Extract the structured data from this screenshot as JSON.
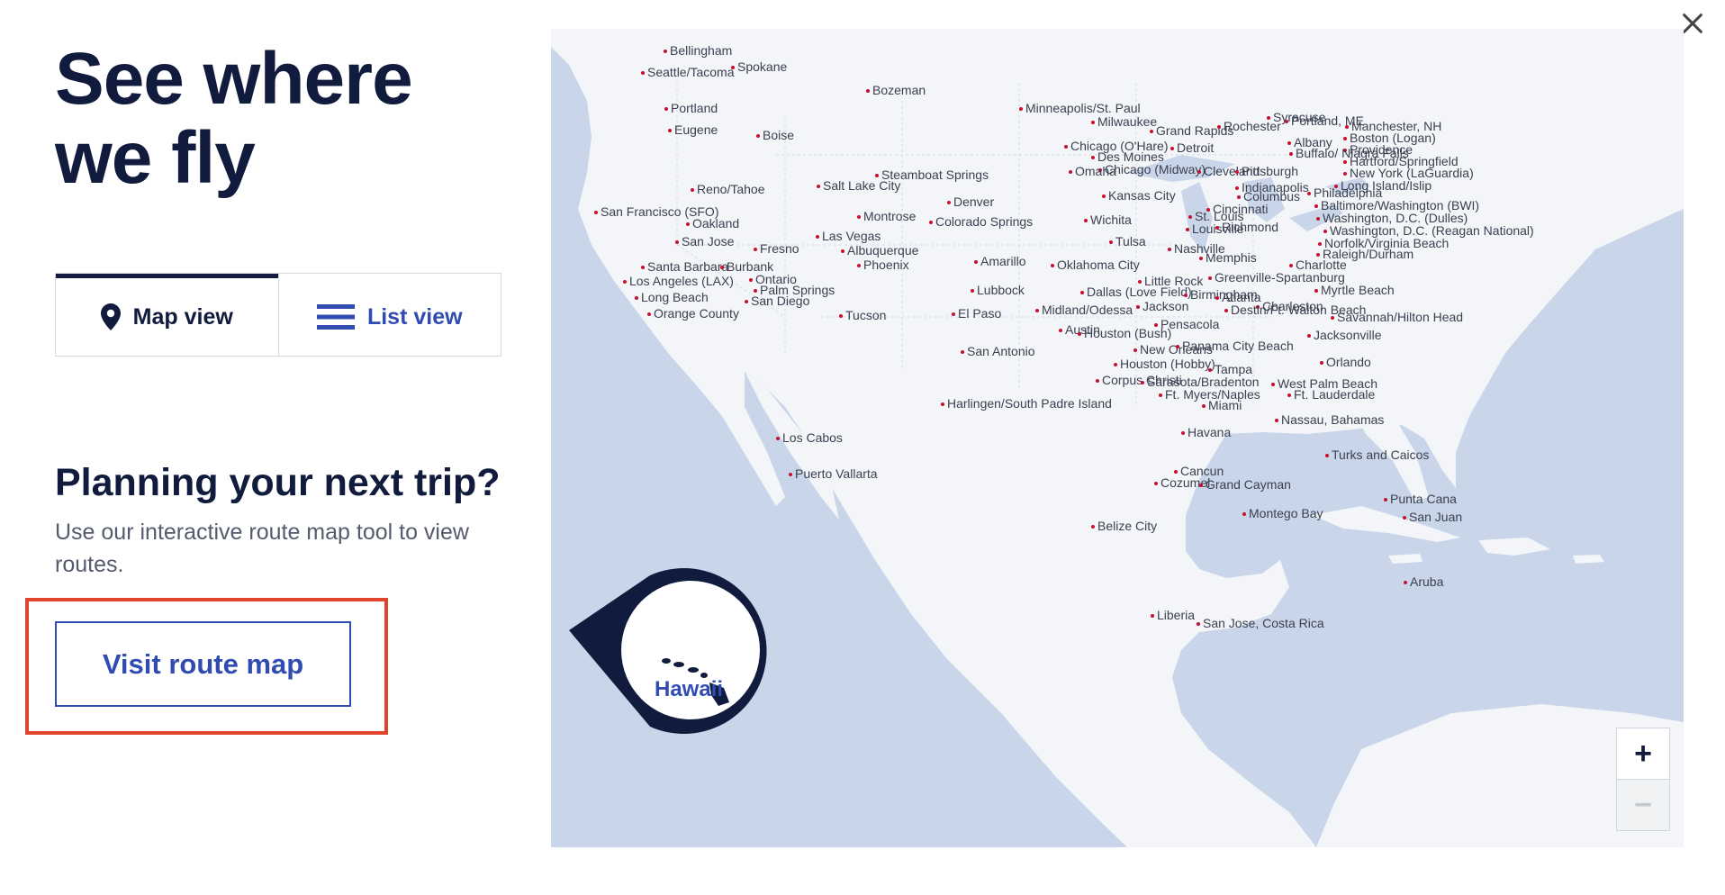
{
  "page": {
    "title": "See where\nwe fly",
    "close_icon": "close-icon"
  },
  "view_toggle": {
    "map_label": "Map view",
    "list_label": "List view",
    "active": "map"
  },
  "planning": {
    "heading": "Planning your next trip?",
    "description": "Use our interactive route map tool to view routes.",
    "button_label": "Visit route map"
  },
  "map": {
    "hawaii_label": "Hawaii",
    "zoom_in_label": "+",
    "zoom_out_label": "−",
    "cities": [
      "Bellingham",
      "Seattle/Tacoma",
      "Spokane",
      "Bozeman",
      "Portland",
      "Eugene",
      "Boise",
      "Minneapolis/St. Paul",
      "Milwaukee",
      "Grand Rapids",
      "Rochester",
      "Syracuse",
      "Portland, ME",
      "Manchester, NH",
      "Boston (Logan)",
      "Providence",
      "Hartford/Springfield",
      "New York (LaGuardia)",
      "Long Island/Islip",
      "Albany",
      "Buffalo/ Niagra Falls",
      "Detroit",
      "Chicago (O'Hare)",
      "Des Moines",
      "Chicago (Midway)",
      "Cleveland",
      "Pittsburgh",
      "Omaha",
      "Reno/Tahoe",
      "Salt Lake City",
      "Steamboat Springs",
      "Denver",
      "Kansas City",
      "Indianapolis",
      "Columbus",
      "Philadelphia",
      "Baltimore/Washington (BWI)",
      "Washington, D.C. (Dulles)",
      "Washington, D.C. (Reagan National)",
      "Norfolk/Virginia Beach",
      "San Francisco (SFO)",
      "Oakland",
      "San Jose",
      "Montrose",
      "Colorado Springs",
      "Wichita",
      "St. Louis",
      "Cincinnati",
      "Louisville",
      "Richmond",
      "Las Vegas",
      "Fresno",
      "Tulsa",
      "Nashville",
      "Raleigh/Durham",
      "Albuquerque",
      "Amarillo",
      "Oklahoma City",
      "Memphis",
      "Charlotte",
      "Santa Barbara",
      "Burbank",
      "Ontario",
      "Phoenix",
      "Los Angeles (LAX)",
      "Palm Springs",
      "Long Beach",
      "San Diego",
      "Orange County",
      "Lubbock",
      "Dallas (Love Field)",
      "Little Rock",
      "Greenville-Spartanburg",
      "Myrtle Beach",
      "Birmingham",
      "Atlanta",
      "Charleston",
      "Tucson",
      "El Paso",
      "Midland/Odessa",
      "Jackson",
      "Destin/Ft. Walton Beach",
      "Savannah/Hilton Head",
      "Austin",
      "Houston (Bush)",
      "Pensacola",
      "Jacksonville",
      "San Antonio",
      "New Orleans",
      "Houston (Hobby)",
      "Panama City Beach",
      "Orlando",
      "Corpus Christi",
      "Tampa",
      "Sarasota/Bradenton",
      "West Palm Beach",
      "Ft. Lauderdale",
      "Harlingen/South Padre Island",
      "Ft. Myers/Naples",
      "Miami",
      "Nassau, Bahamas",
      "Los Cabos",
      "Havana",
      "Turks and Caicos",
      "Cancun",
      "Cozumel",
      "Grand Cayman",
      "Puerto Vallarta",
      "Punta Cana",
      "San Juan",
      "Montego Bay",
      "Belize City",
      "Aruba",
      "Liberia",
      "San Jose, Costa Rica"
    ]
  }
}
